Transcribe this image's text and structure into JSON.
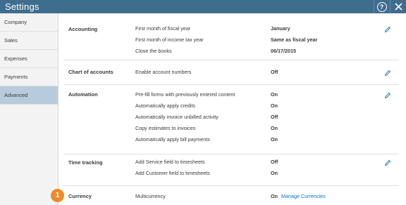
{
  "window": {
    "title": "Settings"
  },
  "sidebar": {
    "items": [
      {
        "label": "Company"
      },
      {
        "label": "Sales"
      },
      {
        "label": "Expenses"
      },
      {
        "label": "Payments"
      },
      {
        "label": "Advanced",
        "active": true
      }
    ]
  },
  "sections": {
    "accounting": {
      "title": "Accounting",
      "rows": [
        {
          "label": "First month of fiscal year",
          "value": "January"
        },
        {
          "label": "First month of income tax year",
          "value": "Same as fiscal year"
        },
        {
          "label": "Close the books",
          "value": "06/17/2015"
        }
      ]
    },
    "chart_of_accounts": {
      "title": "Chart of accounts",
      "rows": [
        {
          "label": "Enable account numbers",
          "value": "Off"
        }
      ]
    },
    "automation": {
      "title": "Automation",
      "rows": [
        {
          "label": "Pre-fill forms with previously entered content",
          "value": "On"
        },
        {
          "label": "Automatically apply credits",
          "value": "On"
        },
        {
          "label": "Automatically invoice unbilled activity",
          "value": "Off"
        },
        {
          "label": "Copy estimates to invoices",
          "value": "On"
        },
        {
          "label": "Automatically apply bill payments",
          "value": "On"
        }
      ]
    },
    "time_tracking": {
      "title": "Time tracking",
      "rows": [
        {
          "label": "Add Service field to timesheets",
          "value": "Off"
        },
        {
          "label": "Add Customer field to timesheets",
          "value": "On"
        }
      ]
    },
    "currency": {
      "title": "Currency",
      "rows": [
        {
          "label": "Multicurrency",
          "value": "On",
          "link": "Manage Currencies"
        }
      ]
    }
  },
  "callout": {
    "number": "1"
  },
  "icons": {
    "help": "help-icon",
    "close": "close-icon",
    "edit": "pencil-icon"
  },
  "colors": {
    "titlebar": "#3f6d8e",
    "link": "#0077c5",
    "callout": "#f08a24",
    "active_nav": "#b7cbdc"
  }
}
